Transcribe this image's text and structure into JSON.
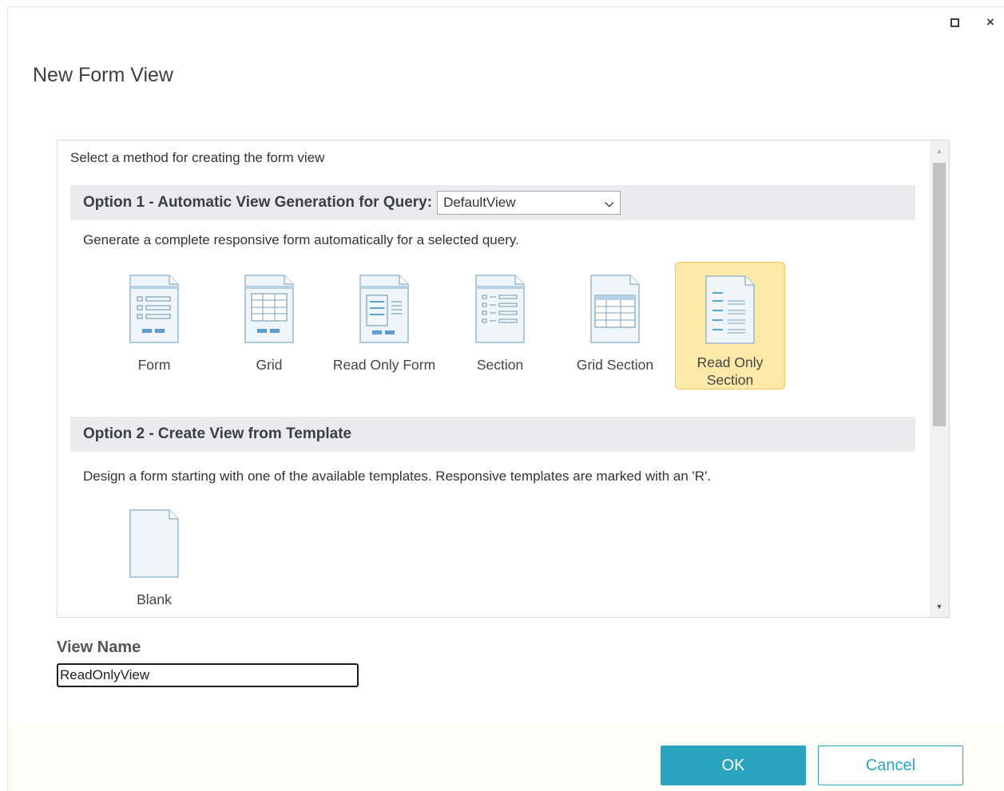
{
  "dialog": {
    "title": "New Form View",
    "maximize_icon": "maximize-icon",
    "close_label": "×"
  },
  "panel": {
    "instructions": "Select a method for creating the form view",
    "option1": {
      "title": "Option 1 - Automatic View Generation for Query:",
      "query_selected": "DefaultView",
      "description": "Generate a complete responsive form automatically for a selected query.",
      "tiles": [
        {
          "label": "Form",
          "icon": "form-icon",
          "selected": false
        },
        {
          "label": "Grid",
          "icon": "grid-icon",
          "selected": false
        },
        {
          "label": "Read Only Form",
          "icon": "read-only-form-icon",
          "selected": false
        },
        {
          "label": "Section",
          "icon": "section-icon",
          "selected": false
        },
        {
          "label": "Grid Section",
          "icon": "grid-section-icon",
          "selected": false
        },
        {
          "label": "Read Only Section",
          "icon": "read-only-section-icon",
          "selected": true
        }
      ]
    },
    "option2": {
      "title": "Option 2 - Create View from Template",
      "description": "Design a form starting with one of the available templates. Responsive templates are marked with an 'R'.",
      "tiles": [
        {
          "label": "Blank",
          "icon": "blank-icon",
          "selected": false
        }
      ]
    }
  },
  "view_name": {
    "label": "View Name",
    "value": "ReadOnlyView"
  },
  "buttons": {
    "ok": "OK",
    "cancel": "Cancel"
  },
  "colors": {
    "accent": "#2aa5c0",
    "selected_tile_bg": "#fde9a7",
    "selected_tile_border": "#f0c458",
    "section_header_bg": "#ebebee"
  }
}
